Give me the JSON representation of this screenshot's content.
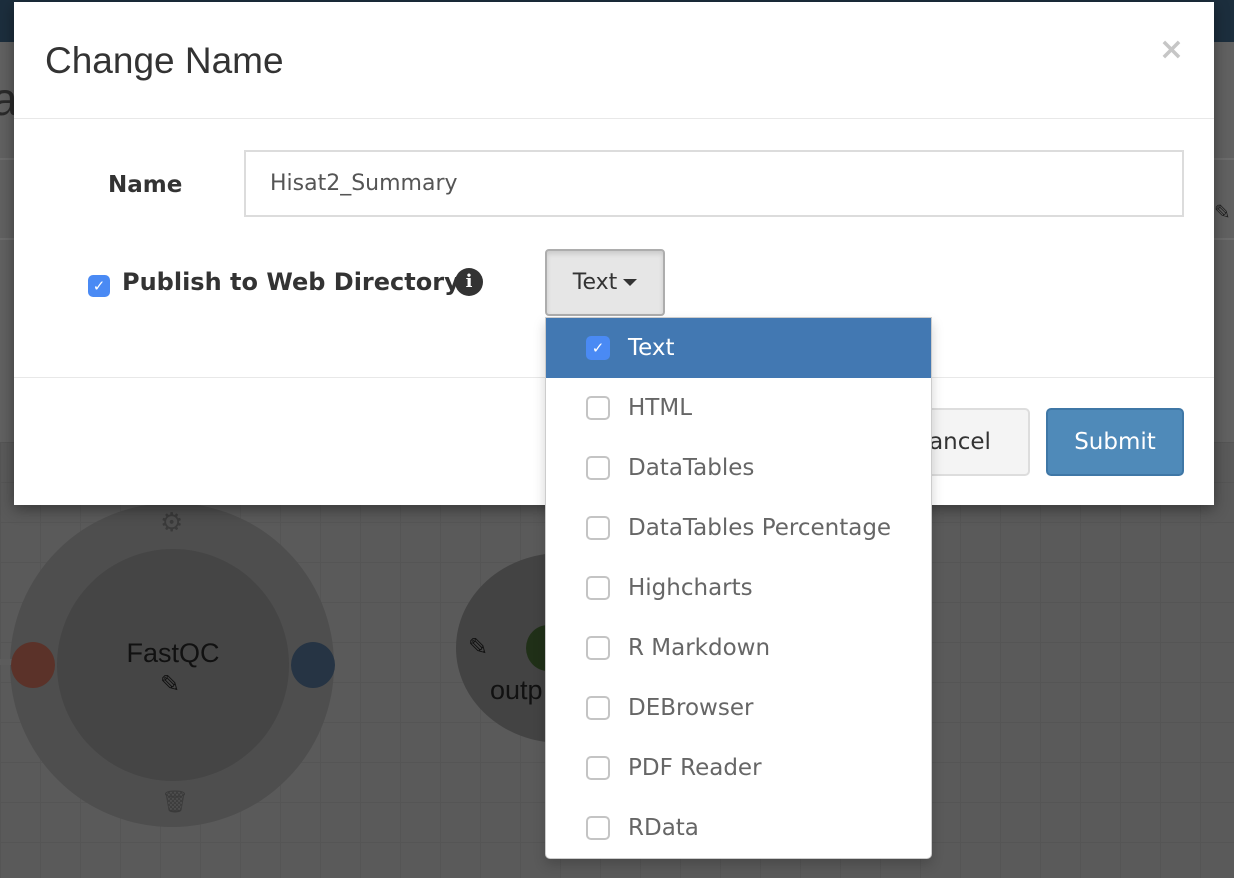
{
  "background": {
    "nodes": [
      {
        "label": "FastQC"
      },
      {
        "label": "outp"
      }
    ]
  },
  "modal": {
    "title": "Change Name",
    "close_icon": "close-icon",
    "name_label": "Name",
    "name_value": "Hisat2_Summary",
    "publish_label": "Publish to Web Directory",
    "publish_checked": true,
    "info_icon": "i",
    "type_button": "Text",
    "cancel": "Cancel",
    "submit": "Submit"
  },
  "dropdown": {
    "items": [
      {
        "label": "Text",
        "checked": true
      },
      {
        "label": "HTML",
        "checked": false
      },
      {
        "label": "DataTables",
        "checked": false
      },
      {
        "label": "DataTables Percentage",
        "checked": false
      },
      {
        "label": "Highcharts",
        "checked": false
      },
      {
        "label": "R Markdown",
        "checked": false
      },
      {
        "label": "DEBrowser",
        "checked": false
      },
      {
        "label": "PDF Reader",
        "checked": false
      },
      {
        "label": "RData",
        "checked": false
      }
    ]
  },
  "colors": {
    "accent": "#4278b2",
    "submit": "#4f8ab9",
    "checkbox": "#4a8af4",
    "topbar": "#1c2e3d"
  }
}
